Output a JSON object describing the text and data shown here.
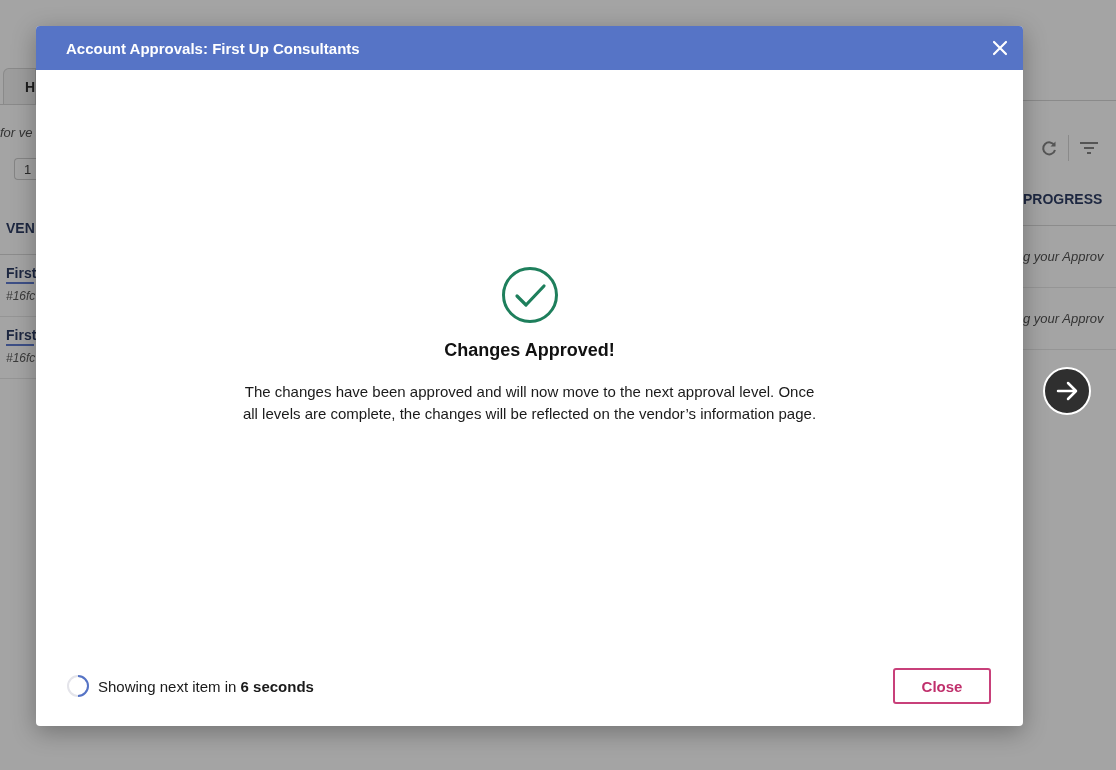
{
  "background": {
    "tab": "H",
    "hint": "for ve",
    "page_field": "1",
    "columns": [
      "VEN",
      "PROGRESS"
    ],
    "rows": [
      {
        "vendor": "First",
        "id": "#16fc",
        "progress": "g your Approv"
      },
      {
        "vendor": "First",
        "id": "#16fc",
        "progress": "g your Approv"
      }
    ]
  },
  "dialog": {
    "title": "Account Approvals: First Up Consultants",
    "message_title": "Changes Approved!",
    "message": "The changes have been approved and will now move to the next approval level. Once all levels are complete, the changes will be reflected on the vendor’s information page.",
    "countdown": "Showing next item in **6 seconds**",
    "close_button": "Close"
  }
}
